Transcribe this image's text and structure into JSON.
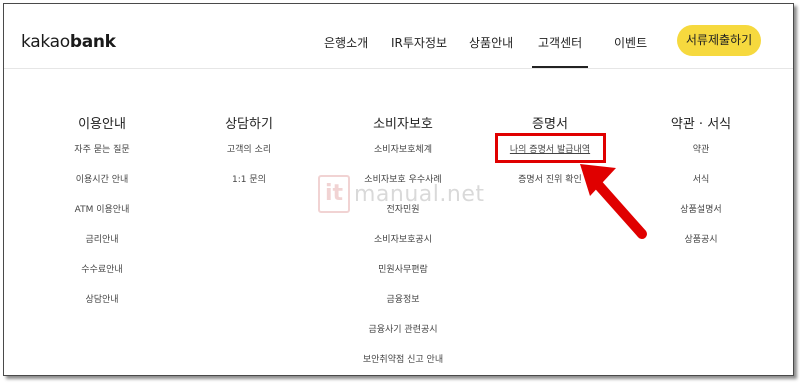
{
  "brand": {
    "logo_light": "kakao",
    "logo_bold": "bank"
  },
  "nav": [
    {
      "label": "은행소개"
    },
    {
      "label": "IR투자정보"
    },
    {
      "label": "상품안내"
    },
    {
      "label": "고객센터",
      "active": true
    },
    {
      "label": "이벤트"
    }
  ],
  "cta": {
    "label": "서류제출하기",
    "color": "#f6d93e"
  },
  "columns": [
    {
      "heading": "이용안내",
      "items": [
        "자주 묻는 질문",
        "이용시간 안내",
        "ATM 이용안내",
        "금리안내",
        "수수료안내",
        "상담안내"
      ]
    },
    {
      "heading": "상담하기",
      "items": [
        "고객의 소리",
        "1:1 문의"
      ]
    },
    {
      "heading": "소비자보호",
      "items": [
        "소비자보호체계",
        "소비자보호 우수사례",
        "전자민원",
        "소비자보호공시",
        "민원사무편람",
        "금융정보",
        "금융사기 관련공시",
        "보안취약점 신고 안내"
      ]
    },
    {
      "heading": "증명서",
      "items": [
        "나의 증명서 발급내역",
        "증명서 진위 확인"
      ]
    },
    {
      "heading": "약관 · 서식",
      "items": [
        "약관",
        "서식",
        "상품설명서",
        "상품공시"
      ]
    }
  ],
  "annotation": {
    "highlight_color": "#e00000",
    "highlighted_item": "나의 증명서 발급내역"
  },
  "watermark": {
    "mark": "it",
    "text": "manual.net"
  }
}
